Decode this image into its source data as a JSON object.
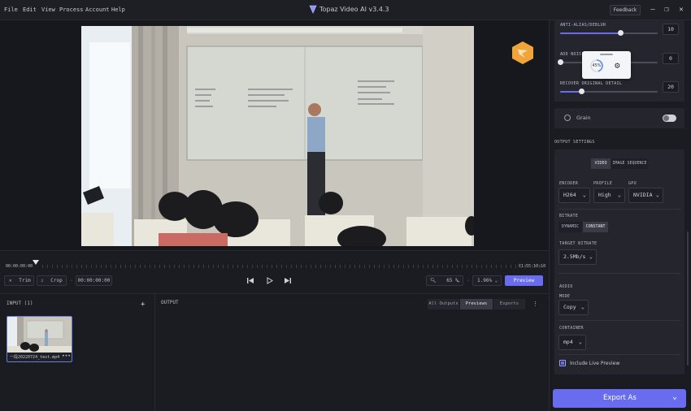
{
  "menu": [
    "File",
    "Edit",
    "View",
    "Process",
    "Account",
    "Help"
  ],
  "app_title": "Topaz Video AI  v3.4.3",
  "feedback_label": "Feedback",
  "video_whiteboard_text": [
    "无人机巡检",
    "无人机巡检与感知技术",
    "无人机巡检与感知"
  ],
  "timeline": {
    "start_time": "00:00:00:00",
    "end_time": "01:55:10:10",
    "trim_label": "Trim",
    "crop_label": "Crop",
    "current_time": "00:00:00:00",
    "zoom": "65 %",
    "speed": "1.96% ⌄",
    "preview_label": "Preview"
  },
  "input": {
    "title": "INPUT (1)",
    "add_icon": "plus-icon",
    "file_name": "一段20220724_test.mp4",
    "more_label": "•••"
  },
  "output": {
    "title": "OUTPUT",
    "tabs": [
      "All Outputs",
      "Previews",
      "Exports"
    ],
    "active_tab": "Previews"
  },
  "settings": {
    "anti_alias_label": "ANTI-ALIAS/DEBLUR",
    "anti_alias_value": "10",
    "anti_alias_fraction": 0.62,
    "add_noise_label": "ADD NOISE",
    "add_noise_value": "0",
    "add_noise_fraction": 0.0,
    "recover_label": "RECOVER ORIGINAL DETAIL",
    "recover_value": "20",
    "recover_fraction": 0.22,
    "progress_popup_value": "45%",
    "grain_label": "Grain",
    "output_settings_title": "OUTPUT SETTINGS",
    "video_tab": "VIDEO",
    "image_sequence_tab": "IMAGE SEQUENCE",
    "encoder_label": "ENCODER",
    "encoder_value": "H264",
    "profile_label": "PROFILE",
    "profile_value": "High",
    "gpu_label": "GPU",
    "gpu_value": "NVIDIA",
    "bitrate_label": "BITRATE",
    "bitrate_dynamic": "DYNAMIC",
    "bitrate_constant": "CONSTANT",
    "target_bitrate_label": "TARGET BITRATE",
    "target_bitrate_value": "2.5Mb/s",
    "audio_label": "AUDIO",
    "mode_label": "MODE",
    "mode_value": "Copy",
    "container_label": "CONTAINER",
    "container_value": "mp4",
    "live_preview_label": "Include Live Preview"
  },
  "export_label": "Export As",
  "colors": {
    "accent": "#6a6cf0",
    "bg": "#1b1c22",
    "card": "#25262d"
  }
}
